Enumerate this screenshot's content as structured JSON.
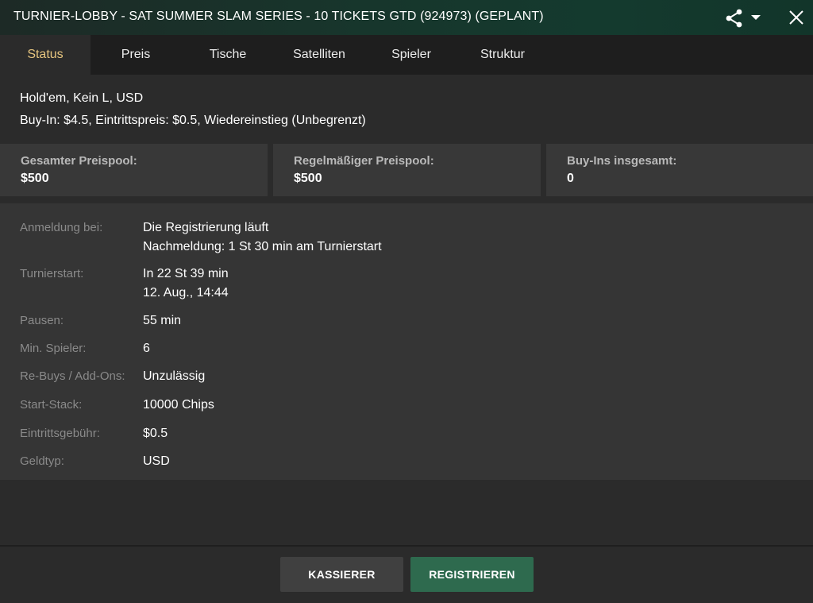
{
  "window": {
    "title": "TURNIER-LOBBY - SAT SUMMER SLAM SERIES - 10 TICKETS GTD (924973) (GEPLANT)"
  },
  "header_icons": {
    "share": "share-icon",
    "dropdown": "caret-down-icon",
    "close": "close-icon"
  },
  "tabs": [
    {
      "label": "Status",
      "active": true
    },
    {
      "label": "Preis",
      "active": false
    },
    {
      "label": "Tische",
      "active": false
    },
    {
      "label": "Satelliten",
      "active": false
    },
    {
      "label": "Spieler",
      "active": false
    },
    {
      "label": "Struktur",
      "active": false
    }
  ],
  "info": {
    "game": "Hold'em, Kein L, USD",
    "buyin": "Buy-In: $4.5, Eintrittspreis: $0.5, Wiedereinstieg (Unbegrenzt)"
  },
  "cards": [
    {
      "label": "Gesamter Preispool:",
      "value": "$500"
    },
    {
      "label": "Regelmäßiger Preispool:",
      "value": "$500"
    },
    {
      "label": "Buy-Ins insgesamt:",
      "value": "0"
    }
  ],
  "details": [
    {
      "label": "Anmeldung bei:",
      "value": "Die Registrierung läuft",
      "value2": "Nachmeldung: 1 St 30 min am Turnierstart"
    },
    {
      "label": "Turnierstart:",
      "value": "In 22 St 39 min",
      "value2": "12. Aug., 14:44"
    },
    {
      "label": "Pausen:",
      "value": "55 min"
    },
    {
      "label": "Min. Spieler:",
      "value": "6"
    },
    {
      "label": "Re-Buys / Add-Ons:",
      "value": "Unzulässig"
    },
    {
      "label": "Start-Stack:",
      "value": "10000 Chips"
    },
    {
      "label": "Eintrittsgebühr:",
      "value": "$0.5"
    },
    {
      "label": "Geldtyp:",
      "value": "USD"
    }
  ],
  "buttons": {
    "cashier": "KASSIERER",
    "register": "REGISTRIEREN"
  },
  "colors": {
    "accent_tab": "#e6c57f",
    "register_green": "#2e6a4e"
  }
}
